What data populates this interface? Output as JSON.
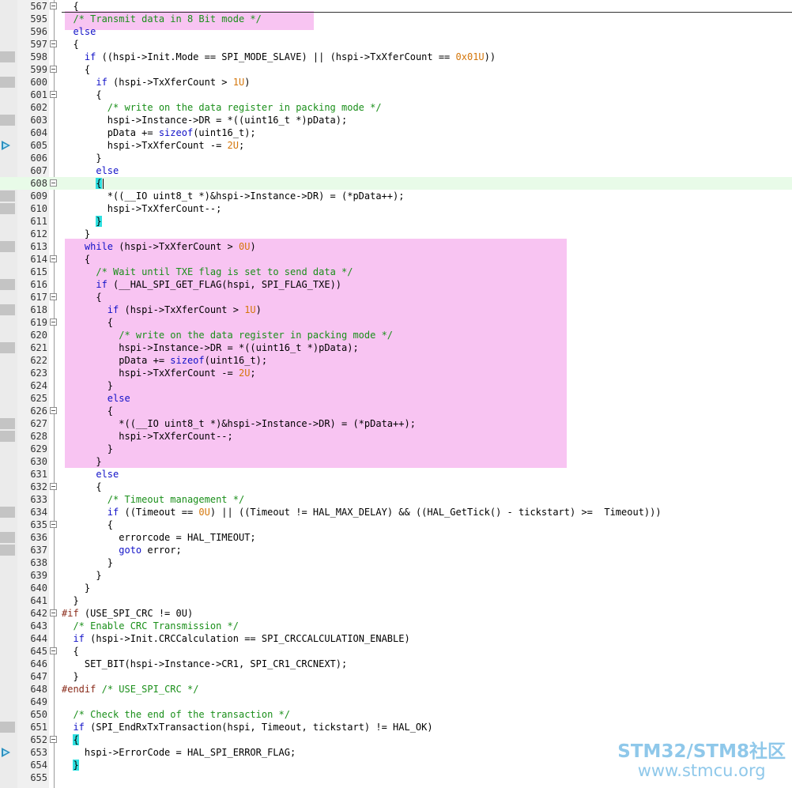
{
  "editor": {
    "lines": [
      {
        "num": "567",
        "fold": true,
        "marker": "",
        "text": "  {"
      },
      {
        "num": "595",
        "fold": false,
        "marker": "",
        "text": "  /* Transmit data in 8 Bit mode */"
      },
      {
        "num": "596",
        "fold": false,
        "marker": "",
        "text": "  else"
      },
      {
        "num": "597",
        "fold": true,
        "marker": "",
        "text": "  {"
      },
      {
        "num": "598",
        "fold": false,
        "marker": "bp",
        "text": "    if ((hspi->Init.Mode == SPI_MODE_SLAVE) || (hspi->TxXferCount == 0x01U))"
      },
      {
        "num": "599",
        "fold": true,
        "marker": "",
        "text": "    {"
      },
      {
        "num": "600",
        "fold": false,
        "marker": "bp",
        "text": "      if (hspi->TxXferCount > 1U)"
      },
      {
        "num": "601",
        "fold": true,
        "marker": "",
        "text": "      {"
      },
      {
        "num": "602",
        "fold": false,
        "marker": "",
        "text": "        /* write on the data register in packing mode */"
      },
      {
        "num": "603",
        "fold": false,
        "marker": "bp",
        "text": "        hspi->Instance->DR = *((uint16_t *)pData);"
      },
      {
        "num": "604",
        "fold": false,
        "marker": "",
        "text": "        pData += sizeof(uint16_t);"
      },
      {
        "num": "605",
        "fold": false,
        "marker": "arrow",
        "text": "        hspi->TxXferCount -= 2U;"
      },
      {
        "num": "606",
        "fold": false,
        "marker": "",
        "text": "      }"
      },
      {
        "num": "607",
        "fold": false,
        "marker": "",
        "text": "      else"
      },
      {
        "num": "608",
        "fold": true,
        "marker": "",
        "text": "      {"
      },
      {
        "num": "609",
        "fold": false,
        "marker": "bp",
        "text": "        *((__IO uint8_t *)&hspi->Instance->DR) = (*pData++);"
      },
      {
        "num": "610",
        "fold": false,
        "marker": "bp",
        "text": "        hspi->TxXferCount--;"
      },
      {
        "num": "611",
        "fold": false,
        "marker": "",
        "text": "      }"
      },
      {
        "num": "612",
        "fold": false,
        "marker": "",
        "text": "    }"
      },
      {
        "num": "613",
        "fold": false,
        "marker": "bp",
        "text": "    while (hspi->TxXferCount > 0U)"
      },
      {
        "num": "614",
        "fold": true,
        "marker": "",
        "text": "    {"
      },
      {
        "num": "615",
        "fold": false,
        "marker": "",
        "text": "      /* Wait until TXE flag is set to send data */"
      },
      {
        "num": "616",
        "fold": false,
        "marker": "bp",
        "text": "      if (__HAL_SPI_GET_FLAG(hspi, SPI_FLAG_TXE))"
      },
      {
        "num": "617",
        "fold": true,
        "marker": "",
        "text": "      {"
      },
      {
        "num": "618",
        "fold": false,
        "marker": "bp",
        "text": "        if (hspi->TxXferCount > 1U)"
      },
      {
        "num": "619",
        "fold": true,
        "marker": "",
        "text": "        {"
      },
      {
        "num": "620",
        "fold": false,
        "marker": "",
        "text": "          /* write on the data register in packing mode */"
      },
      {
        "num": "621",
        "fold": false,
        "marker": "bp",
        "text": "          hspi->Instance->DR = *((uint16_t *)pData);"
      },
      {
        "num": "622",
        "fold": false,
        "marker": "",
        "text": "          pData += sizeof(uint16_t);"
      },
      {
        "num": "623",
        "fold": false,
        "marker": "",
        "text": "          hspi->TxXferCount -= 2U;"
      },
      {
        "num": "624",
        "fold": false,
        "marker": "",
        "text": "        }"
      },
      {
        "num": "625",
        "fold": false,
        "marker": "",
        "text": "        else"
      },
      {
        "num": "626",
        "fold": true,
        "marker": "",
        "text": "        {"
      },
      {
        "num": "627",
        "fold": false,
        "marker": "bp",
        "text": "          *((__IO uint8_t *)&hspi->Instance->DR) = (*pData++);"
      },
      {
        "num": "628",
        "fold": false,
        "marker": "bp",
        "text": "          hspi->TxXferCount--;"
      },
      {
        "num": "629",
        "fold": false,
        "marker": "",
        "text": "        }"
      },
      {
        "num": "630",
        "fold": false,
        "marker": "",
        "text": "      }"
      },
      {
        "num": "631",
        "fold": false,
        "marker": "",
        "text": "      else"
      },
      {
        "num": "632",
        "fold": true,
        "marker": "",
        "text": "      {"
      },
      {
        "num": "633",
        "fold": false,
        "marker": "",
        "text": "        /* Timeout management */"
      },
      {
        "num": "634",
        "fold": false,
        "marker": "bp",
        "text": "        if ((Timeout == 0U) || ((Timeout != HAL_MAX_DELAY) && ((HAL_GetTick() - tickstart) >=  Timeout)))"
      },
      {
        "num": "635",
        "fold": true,
        "marker": "",
        "text": "        {"
      },
      {
        "num": "636",
        "fold": false,
        "marker": "bp",
        "text": "          errorcode = HAL_TIMEOUT;"
      },
      {
        "num": "637",
        "fold": false,
        "marker": "bp",
        "text": "          goto error;"
      },
      {
        "num": "638",
        "fold": false,
        "marker": "",
        "text": "        }"
      },
      {
        "num": "639",
        "fold": false,
        "marker": "",
        "text": "      }"
      },
      {
        "num": "640",
        "fold": false,
        "marker": "",
        "text": "    }"
      },
      {
        "num": "641",
        "fold": false,
        "marker": "",
        "text": "  }"
      },
      {
        "num": "642",
        "fold": true,
        "marker": "",
        "text": "#if (USE_SPI_CRC != 0U)"
      },
      {
        "num": "643",
        "fold": false,
        "marker": "",
        "text": "  /* Enable CRC Transmission */"
      },
      {
        "num": "644",
        "fold": false,
        "marker": "",
        "text": "  if (hspi->Init.CRCCalculation == SPI_CRCCALCULATION_ENABLE)"
      },
      {
        "num": "645",
        "fold": true,
        "marker": "",
        "text": "  {"
      },
      {
        "num": "646",
        "fold": false,
        "marker": "",
        "text": "    SET_BIT(hspi->Instance->CR1, SPI_CR1_CRCNEXT);"
      },
      {
        "num": "647",
        "fold": false,
        "marker": "",
        "text": "  }"
      },
      {
        "num": "648",
        "fold": false,
        "marker": "",
        "text": "#endif /* USE_SPI_CRC */"
      },
      {
        "num": "649",
        "fold": false,
        "marker": "",
        "text": ""
      },
      {
        "num": "650",
        "fold": false,
        "marker": "",
        "text": "  /* Check the end of the transaction */"
      },
      {
        "num": "651",
        "fold": false,
        "marker": "bp",
        "text": "  if (SPI_EndRxTxTransaction(hspi, Timeout, tickstart) != HAL_OK)"
      },
      {
        "num": "652",
        "fold": true,
        "marker": "",
        "text": "  {"
      },
      {
        "num": "653",
        "fold": false,
        "marker": "arrow",
        "text": "    hspi->ErrorCode = HAL_SPI_ERROR_FLAG;"
      },
      {
        "num": "654",
        "fold": false,
        "marker": "",
        "text": "  }"
      },
      {
        "num": "655",
        "fold": false,
        "marker": "",
        "text": ""
      }
    ],
    "active_line": "608",
    "brace_match_lines": [
      "608",
      "611",
      "652",
      "654"
    ],
    "highlight_color": "#f8c4f2"
  },
  "watermark": {
    "brand": "STM32/STM8社区",
    "url": "www.stmcu.org"
  },
  "colors": {
    "comment": "#1a8f1a",
    "keyword": "#1212c8",
    "number": "#d4760a",
    "preprocessor": "#8a2b1a",
    "brace_match": "#2ee0e0"
  }
}
